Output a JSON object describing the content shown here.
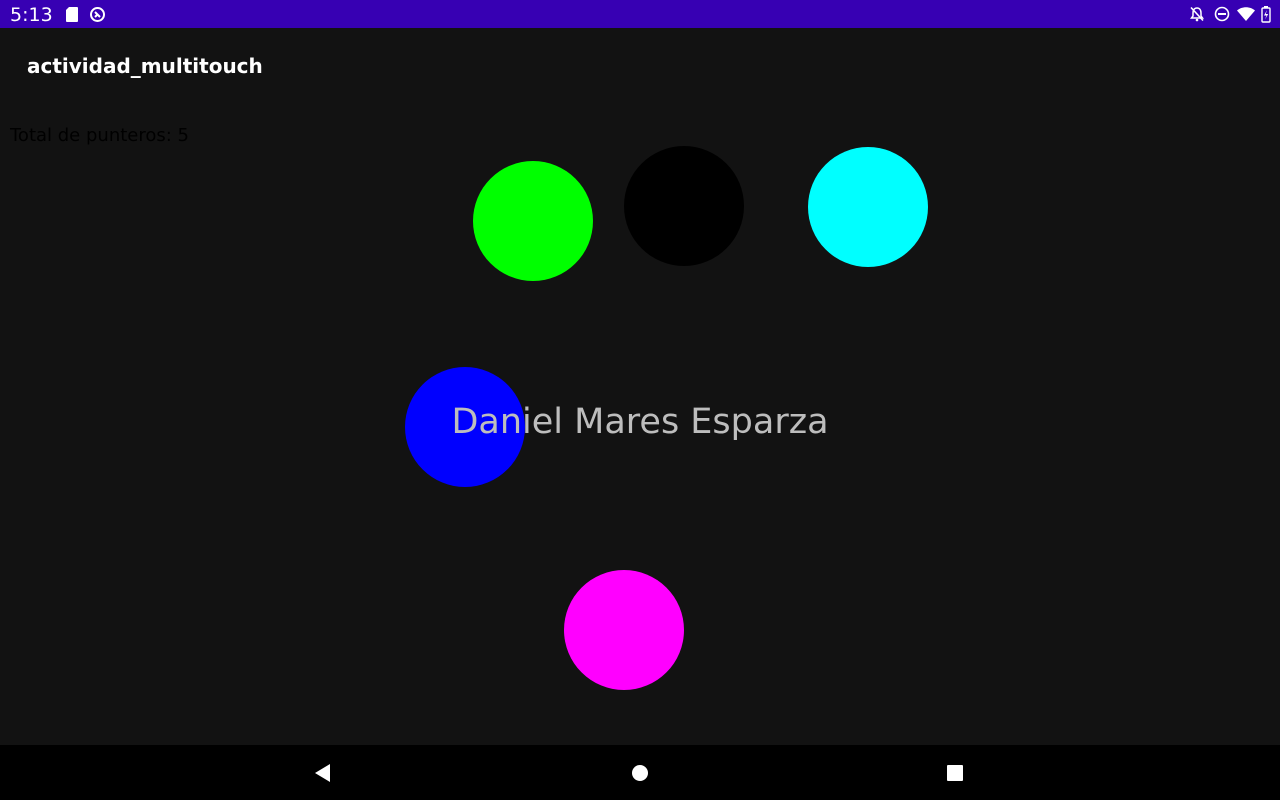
{
  "status_bar": {
    "time": "5:13",
    "left_icons": [
      "sd-card-icon",
      "sync-icon"
    ],
    "right_icons": [
      "notifications-off-icon",
      "do-not-disturb-icon",
      "wifi-icon",
      "battery-charging-icon"
    ],
    "background": "#3700b3"
  },
  "app_bar": {
    "title": "actividad_multitouch"
  },
  "canvas": {
    "pointer_count_text": "Total de punteros: 5",
    "center_text": "Daniel Mares Esparza",
    "pointers": [
      {
        "name": "green",
        "color": "#00ff00"
      },
      {
        "name": "black",
        "color": "#000000"
      },
      {
        "name": "cyan",
        "color": "#00ffff"
      },
      {
        "name": "blue",
        "color": "#0000ff"
      },
      {
        "name": "magenta",
        "color": "#ff00ff"
      }
    ]
  },
  "nav_bar": {
    "buttons": [
      "back-icon",
      "home-icon",
      "recents-icon"
    ]
  }
}
